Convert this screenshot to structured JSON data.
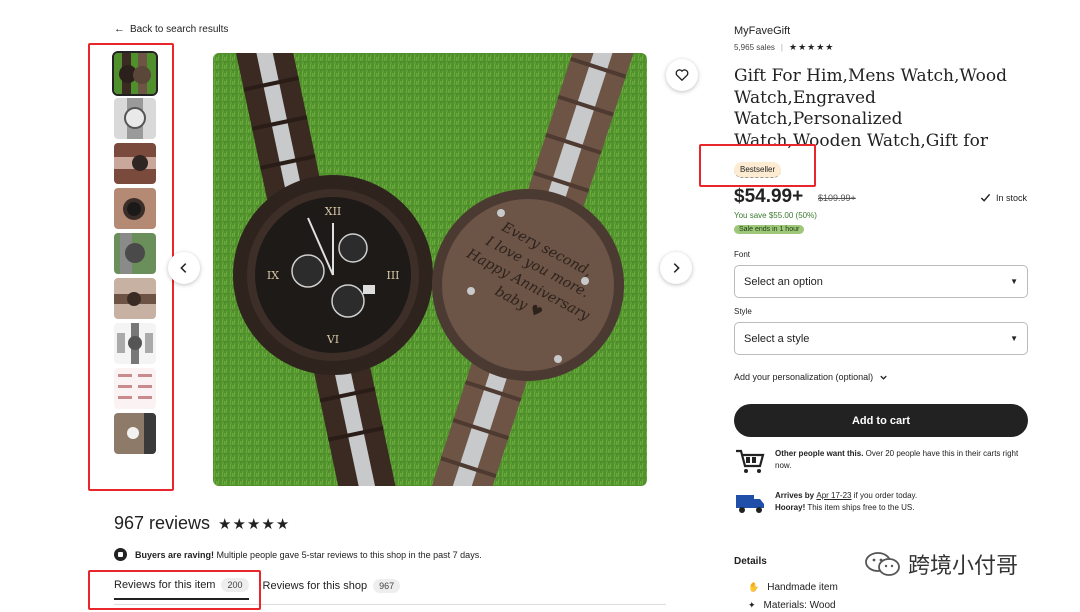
{
  "nav": {
    "back_label": "Back to search results"
  },
  "gallery": {
    "thumbnails": [
      "thumb-1",
      "thumb-2",
      "thumb-3",
      "thumb-4",
      "thumb-5",
      "thumb-6",
      "thumb-7",
      "thumb-8",
      "thumb-9"
    ],
    "active_index": 0,
    "engraving_lines": [
      "Every second,",
      "I love you more.",
      "Happy Anniversary",
      "baby ♥"
    ],
    "watch_numerals": [
      "XII",
      "III",
      "VI",
      "IX"
    ],
    "image_colors": {
      "grass": "#4f8f2c",
      "wood_dark": "#3a2a22",
      "wood_light": "#6d5445",
      "steel": "#c7c9cb"
    }
  },
  "reviews": {
    "count_label": "967 reviews",
    "stars": "★★★★★",
    "raving_bold": "Buyers are raving!",
    "raving_text": " Multiple people gave 5-star reviews to this shop in the past 7 days.",
    "tabs": [
      {
        "label": "Reviews for this item",
        "count": "200"
      },
      {
        "label": "Reviews for this shop",
        "count": "967"
      }
    ]
  },
  "product": {
    "shop_name": "MyFaveGift",
    "sales": "5,965 sales",
    "shop_stars": "★★★★★",
    "title": "Gift For Him,Mens Watch,Wood Watch,Engraved Watch,Personalized Watch,Wooden Watch,Gift for Boyfriend,Husband,Dad,Fiance,Son",
    "badge": "Bestseller",
    "price": "$54.99+",
    "old_price": "$109.99+",
    "stock": "In stock",
    "save": "You save $55.00 (50%)",
    "sale_ends": "Sale ends in 1 hour",
    "font_label": "Font",
    "font_placeholder": "Select an option",
    "style_label": "Style",
    "style_placeholder": "Select a style",
    "personalization": "Add your personalization (optional)",
    "add_to_cart": "Add to cart",
    "demand_bold": "Other people want this.",
    "demand_text": " Over 20 people have this in their carts right now.",
    "arrival_prefix": "Arrives by ",
    "arrival_dates": "Apr 17-23",
    "arrival_suffix": " if you order today.",
    "hooray_bold": "Hooray!",
    "hooray_text": " This item ships free to the US.",
    "details_heading": "Details",
    "details": [
      "Handmade item",
      "Materials: Wood"
    ]
  },
  "watermark": {
    "text": "跨境小付哥"
  },
  "colors": {
    "annotation_red": "#e8262b",
    "sale_green": "#9ec77a",
    "badge_bg": "#fdebd2",
    "cart_bg": "#222222"
  }
}
